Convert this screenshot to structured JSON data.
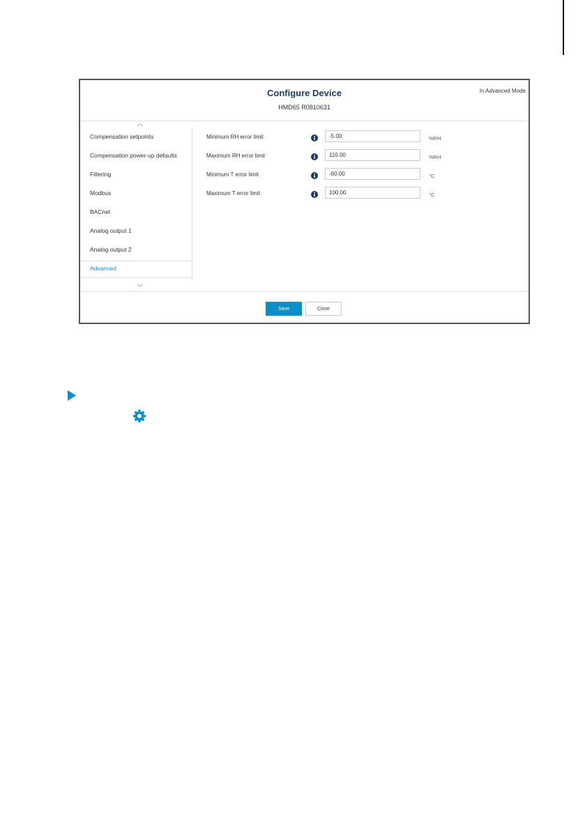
{
  "dialog": {
    "title": "Configure Device",
    "subtitle": "HMD65 R0810631",
    "mode_label": "In Advanced Mode"
  },
  "sidebar": {
    "items": [
      {
        "label": "Compensation setpoints",
        "active": false
      },
      {
        "label": "Compensation power-up defaults",
        "active": false
      },
      {
        "label": "Filtering",
        "active": false
      },
      {
        "label": "Modbus",
        "active": false
      },
      {
        "label": "BACnet",
        "active": false
      },
      {
        "label": "Analog output 1",
        "active": false
      },
      {
        "label": "Analog output 2",
        "active": false
      },
      {
        "label": "Advanced",
        "active": true
      }
    ]
  },
  "fields": [
    {
      "label": "Minimum RH error limit",
      "value": "-5.00",
      "unit": "%RH"
    },
    {
      "label": "Maximum RH error limit",
      "value": "110.00",
      "unit": "%RH"
    },
    {
      "label": "Minimum T error limit",
      "value": "-60.00",
      "unit": "°C"
    },
    {
      "label": "Maximum T error limit",
      "value": "100.00",
      "unit": "°C"
    }
  ],
  "buttons": {
    "save_label": "Save",
    "close_label": "Close"
  },
  "icons": {
    "info": "info-icon",
    "scroll_up": "chevron-up-icon",
    "scroll_down": "chevron-down-icon",
    "step_arrow": "play-icon",
    "settings": "gear-icon"
  },
  "colors": {
    "accent": "#0a8fc7",
    "title": "#1c3a5a",
    "info_icon": "#1c3a5a"
  }
}
